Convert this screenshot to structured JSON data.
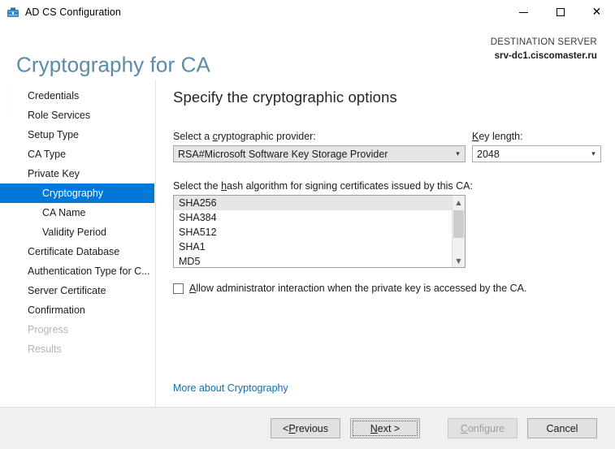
{
  "window": {
    "title": "AD CS Configuration",
    "icon": "ad-cs-configuration-icon",
    "minimize_label": "Minimize",
    "maximize_label": "Maximize",
    "close_label": "Close"
  },
  "header": {
    "page_title": "Cryptography for CA",
    "destination_label": "DESTINATION SERVER",
    "destination_server": "srv-dc1.ciscomaster.ru",
    "title_color": "#5a8ba8"
  },
  "sidebar": {
    "items": [
      {
        "label": "Credentials",
        "state": "enabled",
        "indent": false
      },
      {
        "label": "Role Services",
        "state": "enabled",
        "indent": false
      },
      {
        "label": "Setup Type",
        "state": "enabled",
        "indent": false
      },
      {
        "label": "CA Type",
        "state": "enabled",
        "indent": false
      },
      {
        "label": "Private Key",
        "state": "enabled",
        "indent": false
      },
      {
        "label": "Cryptography",
        "state": "selected",
        "indent": true
      },
      {
        "label": "CA Name",
        "state": "enabled",
        "indent": true
      },
      {
        "label": "Validity Period",
        "state": "enabled",
        "indent": true
      },
      {
        "label": "Certificate Database",
        "state": "enabled",
        "indent": false
      },
      {
        "label": "Authentication Type for C...",
        "state": "enabled",
        "indent": false
      },
      {
        "label": "Server Certificate",
        "state": "enabled",
        "indent": false
      },
      {
        "label": "Confirmation",
        "state": "enabled",
        "indent": false
      },
      {
        "label": "Progress",
        "state": "disabled",
        "indent": false
      },
      {
        "label": "Results",
        "state": "disabled",
        "indent": false
      }
    ],
    "selected_color": "#0078d7"
  },
  "main": {
    "heading": "Specify the cryptographic options",
    "provider": {
      "label_prefix": "Select a ",
      "label_accesskey": "c",
      "label_suffix": "ryptographic provider:",
      "value": "RSA#Microsoft Software Key Storage Provider",
      "arrow_icon": "chevron-down-icon",
      "options": [
        "RSA#Microsoft Software Key Storage Provider"
      ]
    },
    "key_length": {
      "label_accesskey": "K",
      "label_suffix": "ey length:",
      "value": "2048",
      "arrow_icon": "chevron-down-icon",
      "options": [
        "2048"
      ]
    },
    "hash": {
      "label_prefix": "Select the ",
      "label_accesskey": "h",
      "label_suffix": "ash algorithm for signing certificates issued by this CA:",
      "items": [
        {
          "label": "SHA256",
          "selected": true
        },
        {
          "label": "SHA384",
          "selected": false
        },
        {
          "label": "SHA512",
          "selected": false
        },
        {
          "label": "SHA1",
          "selected": false
        },
        {
          "label": "MD5",
          "selected": false
        }
      ],
      "scroll_up_icon": "chevron-up-icon",
      "scroll_down_icon": "chevron-down-icon"
    },
    "allow_admin": {
      "checked": false,
      "label_accesskey": "A",
      "label_suffix": "llow administrator interaction when the private key is accessed by the CA."
    },
    "more_link": "More about Cryptography"
  },
  "footer": {
    "previous": {
      "prefix": "< ",
      "accesskey": "P",
      "suffix": "revious",
      "state": "enabled"
    },
    "next": {
      "accesskey": "N",
      "suffix": "ext >",
      "state": "focused"
    },
    "configure": {
      "accesskey": "C",
      "suffix": "onfigure",
      "state": "disabled"
    },
    "cancel": {
      "label": "Cancel",
      "state": "enabled"
    }
  }
}
